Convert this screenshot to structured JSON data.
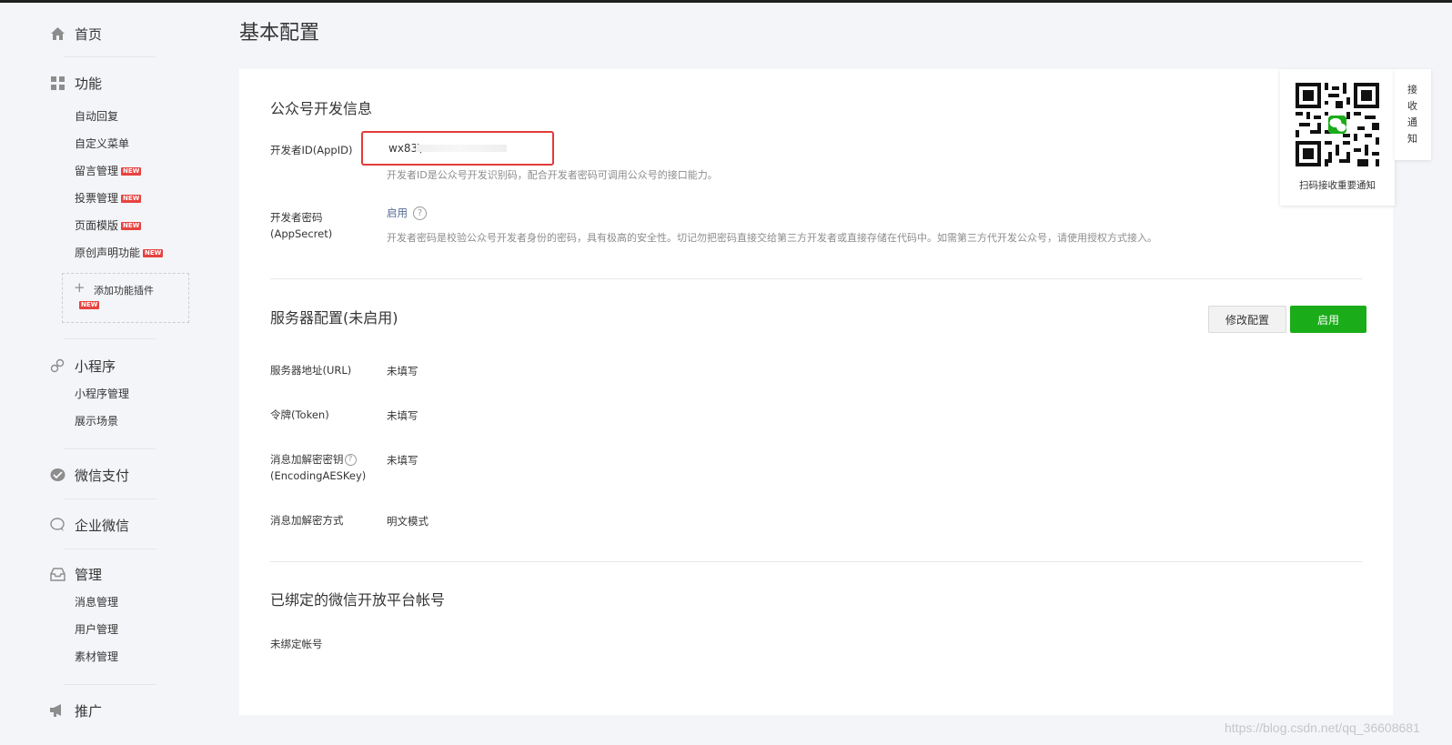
{
  "sidebar": {
    "home": {
      "label": "首页",
      "icon": "home-icon"
    },
    "features": {
      "label": "功能",
      "icon": "grid-icon",
      "items": [
        {
          "label": "自动回复",
          "is_new": false
        },
        {
          "label": "自定义菜单",
          "is_new": false
        },
        {
          "label": "留言管理",
          "is_new": true
        },
        {
          "label": "投票管理",
          "is_new": true
        },
        {
          "label": "页面模版",
          "is_new": true
        },
        {
          "label": "原创声明功能",
          "is_new": true
        }
      ],
      "add_plugin": "添加功能插件",
      "new_badge": "NEW"
    },
    "miniprogram": {
      "label": "小程序",
      "icon": "link-icon",
      "items": [
        "小程序管理",
        "展示场景"
      ]
    },
    "wechat_pay": {
      "label": "微信支付",
      "icon": "pay-icon"
    },
    "work_wechat": {
      "label": "企业微信",
      "icon": "chat-bubble-icon"
    },
    "manage": {
      "label": "管理",
      "icon": "inbox-icon",
      "items": [
        "消息管理",
        "用户管理",
        "素材管理"
      ]
    },
    "promote": {
      "label": "推广",
      "icon": "megaphone-icon"
    }
  },
  "page": {
    "title": "基本配置"
  },
  "dev_info": {
    "title": "公众号开发信息",
    "appid_label": "开发者ID(AppID)",
    "appid_value": "wx83\\",
    "appid_desc": "开发者ID是公众号开发识别码，配合开发者密码可调用公众号的接口能力。",
    "secret_label_1": "开发者密码",
    "secret_label_2": "(AppSecret)",
    "secret_action": "启用",
    "secret_desc": "开发者密码是校验公众号开发者身份的密码，具有极高的安全性。切记勿把密码直接交给第三方开发者或直接存储在代码中。如需第三方代开发公众号，请使用授权方式接入。"
  },
  "server": {
    "title": "服务器配置(未启用)",
    "edit_button": "修改配置",
    "enable_button": "启用",
    "rows": [
      {
        "label": "服务器地址(URL)",
        "value": "未填写"
      },
      {
        "label": "令牌(Token)",
        "value": "未填写"
      },
      {
        "label": "消息加解密密钥",
        "label2": "(EncodingAESKey)",
        "value": "未填写"
      },
      {
        "label": "消息加解密方式",
        "value": "明文模式"
      }
    ]
  },
  "open_platform": {
    "title": "已绑定的微信开放平台帐号",
    "value": "未绑定帐号"
  },
  "qr": {
    "caption": "扫码接收重要通知"
  },
  "side_tab": {
    "chars": [
      "接",
      "收",
      "通",
      "知"
    ]
  },
  "watermark": "https://blog.csdn.net/qq_36608681",
  "colors": {
    "primary_green": "#1aad19",
    "link_blue": "#576b95",
    "highlight_red": "#e23b3b"
  }
}
